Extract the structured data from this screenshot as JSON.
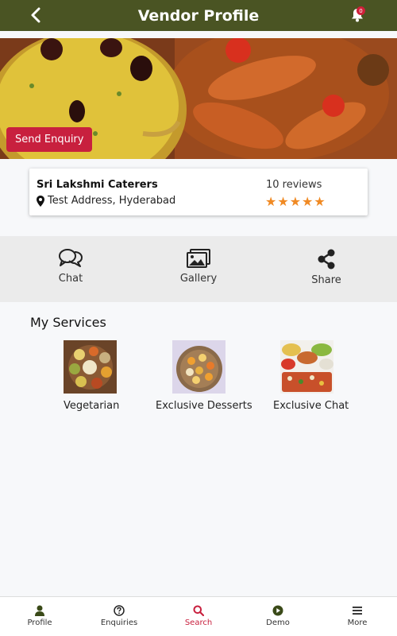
{
  "header": {
    "title": "Vendor Profile",
    "notification_count": "0"
  },
  "hero": {
    "enquiry_label": "Send Enquiry"
  },
  "vendor": {
    "name": "Sri Lakshmi Caterers",
    "address": "Test Address, Hyderabad",
    "reviews": "10 reviews",
    "rating": 5
  },
  "actions": [
    {
      "label": "Chat",
      "icon": "chat-icon"
    },
    {
      "label": "Gallery",
      "icon": "gallery-icon"
    },
    {
      "label": "Share",
      "icon": "share-icon"
    }
  ],
  "services": {
    "title": "My Services",
    "items": [
      {
        "label": "Vegetarian"
      },
      {
        "label": "Exclusive Desserts"
      },
      {
        "label": "Exclusive Chat"
      }
    ]
  },
  "nav": [
    {
      "label": "Profile",
      "icon": "user-icon"
    },
    {
      "label": "Enquiries",
      "icon": "question-icon"
    },
    {
      "label": "Search",
      "icon": "search-icon",
      "active": true
    },
    {
      "label": "Demo",
      "icon": "play-icon"
    },
    {
      "label": "More",
      "icon": "menu-icon"
    }
  ],
  "colors": {
    "header": "#4a5423",
    "accent": "#c8203e",
    "star": "#f08a24"
  }
}
